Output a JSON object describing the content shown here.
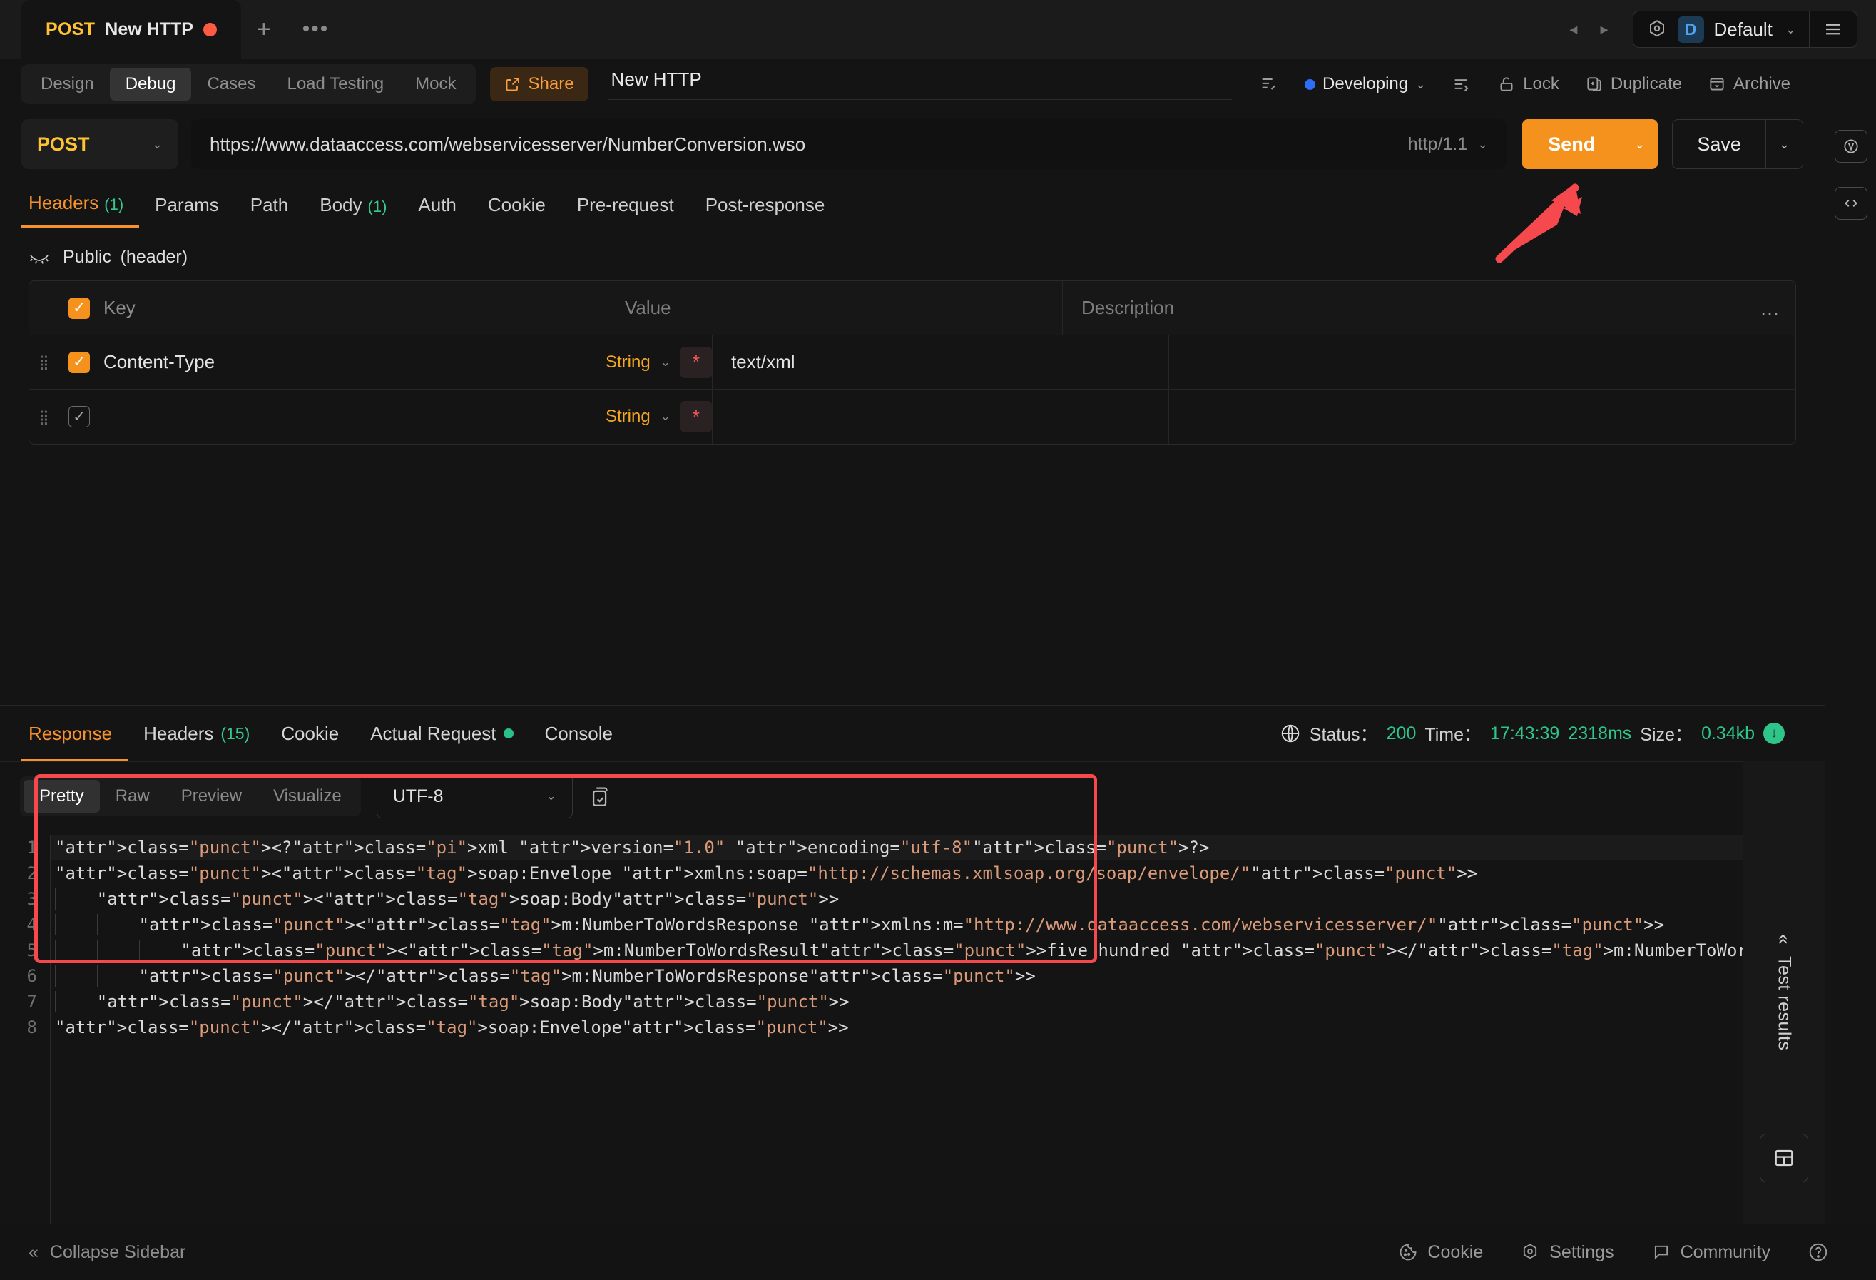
{
  "tabbar": {
    "tab": {
      "method": "POST",
      "name": "New HTTP",
      "dirty_icon": "unsaved-dot"
    },
    "new_tab_label": "+",
    "more_label": "•••",
    "nav_back": "◂",
    "nav_forward": "▸",
    "environment": {
      "badge": "D",
      "name": "Default",
      "chevron": "⌄"
    },
    "menu_icon": "hamburger-icon"
  },
  "modes": {
    "items": [
      "Design",
      "Debug",
      "Cases",
      "Load Testing",
      "Mock"
    ],
    "active": "Debug",
    "share_label": "Share",
    "request_title": "New HTTP",
    "doc_icon": "document-edit-icon",
    "status_label": "Developing",
    "status_chevron": "⌄",
    "sort_icon": "indent-icon",
    "actions": [
      {
        "label": "Lock",
        "icon": "lock-icon"
      },
      {
        "label": "Duplicate",
        "icon": "duplicate-icon"
      },
      {
        "label": "Archive",
        "icon": "archive-icon"
      }
    ]
  },
  "url_row": {
    "method": "POST",
    "method_chevron": "⌄",
    "url": "https://www.dataaccess.com/webservicesserver/NumberConversion.wso",
    "http_version": "http/1.1",
    "http_chevron": "⌄",
    "send_label": "Send",
    "send_chevron": "⌄",
    "save_label": "Save",
    "save_chevron": "⌄"
  },
  "request_tabs": {
    "items": [
      {
        "label": "Headers",
        "count": "(1)",
        "active": true
      },
      {
        "label": "Params",
        "count": "",
        "active": false
      },
      {
        "label": "Path",
        "count": "",
        "active": false
      },
      {
        "label": "Body",
        "count": "(1)",
        "active": false
      },
      {
        "label": "Auth",
        "count": "",
        "active": false
      },
      {
        "label": "Cookie",
        "count": "",
        "active": false
      },
      {
        "label": "Pre-request",
        "count": "",
        "active": false
      },
      {
        "label": "Post-response",
        "count": "",
        "active": false
      }
    ]
  },
  "public_header": {
    "icon": "closed-eye-icon",
    "label": "Public (header)"
  },
  "headers_table": {
    "columns": {
      "key": "Key",
      "value": "Value",
      "description": "Description",
      "more": "…"
    },
    "rows": [
      {
        "checked": true,
        "key": "Content-Type",
        "type": "String",
        "type_chevron": "⌄",
        "required_icon": "*",
        "value": "text/xml",
        "description": ""
      },
      {
        "checked": false,
        "key": "",
        "type": "String",
        "type_chevron": "⌄",
        "required_icon": "*",
        "value": "",
        "description": ""
      }
    ]
  },
  "response": {
    "tabs": [
      {
        "label": "Response",
        "count": "",
        "dot": false,
        "active": true
      },
      {
        "label": "Headers",
        "count": "(15)",
        "dot": false,
        "active": false
      },
      {
        "label": "Cookie",
        "count": "",
        "dot": false,
        "active": false
      },
      {
        "label": "Actual Request",
        "count": "",
        "dot": true,
        "active": false
      },
      {
        "label": "Console",
        "count": "",
        "dot": false,
        "active": false
      }
    ],
    "status": {
      "globe_icon": "globe-icon",
      "status_label": "Status：",
      "status_value": "200",
      "time_label": "Time：",
      "time_value": "17:43:39",
      "duration_value": "2318ms",
      "size_label": "Size：",
      "size_value": "0.34kb",
      "download_icon": "download-badge"
    },
    "toolbar": {
      "formats": [
        "Pretty",
        "Raw",
        "Preview",
        "Visualize"
      ],
      "active_format": "Pretty",
      "encoding": "UTF-8",
      "encoding_chevron": "⌄",
      "copy_icon": "copy-icon"
    },
    "code": {
      "language": "xml",
      "line_numbers": [
        "1",
        "2",
        "3",
        "4",
        "5",
        "6",
        "7",
        "8"
      ],
      "lines": [
        "<?xml version=\"1.0\" encoding=\"utf-8\"?>",
        "<soap:Envelope xmlns:soap=\"http://schemas.xmlsoap.org/soap/envelope/\">",
        "    <soap:Body>",
        "        <m:NumberToWordsResponse xmlns:m=\"http://www.dataaccess.com/webservicesserver/\">",
        "            <m:NumberToWordsResult>five hundred </m:NumberToWordsResult>",
        "        </m:NumberToWordsResponse>",
        "    </soap:Body>",
        "</soap:Envelope>"
      ]
    },
    "test_results": {
      "label": "Test results",
      "collapse_icon": "«",
      "layout_icon": "layout-icon"
    }
  },
  "statusbar": {
    "collapse_icon": "«",
    "collapse_label": "Collapse Sidebar",
    "items": [
      {
        "label": "Cookie",
        "icon": "cookie-icon"
      },
      {
        "label": "Settings",
        "icon": "gear-icon"
      },
      {
        "label": "Community",
        "icon": "chat-icon"
      }
    ],
    "help_icon": "help-icon"
  },
  "colors": {
    "accent_orange": "#f5921e",
    "method_yellow": "#ffc233",
    "success_green": "#2ec48a",
    "annotation_red": "#f5494d",
    "status_blue": "#2f6df6"
  }
}
